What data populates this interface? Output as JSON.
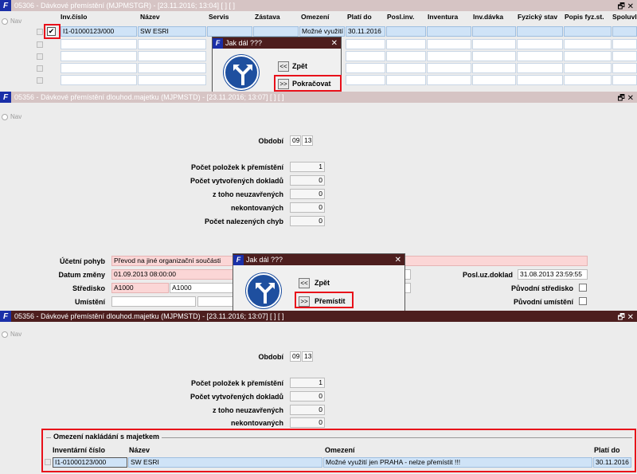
{
  "win1": {
    "title": "05306 - Dávkové přemístění (MJPMSTGR) - [23.11.2016; 13:04]  [ ]  [ ]",
    "nav": "Nav",
    "columns": [
      "Inv.číslo",
      "Název",
      "Servis",
      "Zástava",
      "Omezení",
      "Platí do",
      "Posl.inv.",
      "Inventura",
      "Inv.dávka",
      "Fyzický stav",
      "Popis fyz.st.",
      "Spoluvla"
    ],
    "row": {
      "inv": "I1-01000123/000",
      "name": "SW ESRI",
      "omezeni": "Možné využití",
      "plati": "30.11.2016",
      "check": "✔"
    },
    "dialog": {
      "title": "Jak dál ???",
      "close": "✕",
      "back_btn": "<<",
      "back_label": "Zpět",
      "next_btn": ">>",
      "next_label": "Pokračovat"
    }
  },
  "win2": {
    "title": "05356 - Dávkové přemístění dlouhod.majetku (MJPMSTD) - [23.11.2016; 13:07]  [ ]  [ ]",
    "nav": "Nav",
    "obdobi_label": "Období",
    "obdobi": [
      "09",
      "13"
    ],
    "stats": [
      {
        "label": "Počet položek k přemístění",
        "value": "1"
      },
      {
        "label": "Počet vytvořených dokladů",
        "value": "0"
      },
      {
        "label": "z toho     neuzavřených",
        "value": "0"
      },
      {
        "label": "nekontovaných",
        "value": "0"
      },
      {
        "label": "Počet nalezených chyb",
        "value": "0"
      }
    ],
    "ucetni_pohyb_label": "Účetní pohyb",
    "ucetni_pohyb": "Převod na jiné organizační součásti",
    "datum_zmeny_label": "Datum změny",
    "datum_zmeny": "01.09.2013 08:00:00",
    "stredisko_label": "Středisko",
    "stredisko": "A1000",
    "stredisko2": "A1000",
    "umisteni_label": "Umístění",
    "posl_doklad_label": "Posl.uz.doklad",
    "posl_doklad": "31.08.2013 23:59:55",
    "puvodni_stredisko_label": "Původní středisko",
    "puvodni_umisteni_label": "Původní umístění",
    "dialog": {
      "title": "Jak dál ???",
      "close": "✕",
      "back_btn": "<<",
      "back_label": "Zpět",
      "next_btn": ">>",
      "next_label": "Přemístit"
    }
  },
  "win3": {
    "title": "05356 - Dávkové přemístění dlouhod.majetku (MJPMSTD) - [23.11.2016; 13:07]  [ ]  [ ]",
    "nav": "Nav",
    "obdobi_label": "Období",
    "obdobi": [
      "09",
      "13"
    ],
    "stats": [
      {
        "label": "Počet položek k přemístění",
        "value": "1"
      },
      {
        "label": "Počet vytvořených dokladů",
        "value": "0"
      },
      {
        "label": "z toho     neuzavřených",
        "value": "0"
      },
      {
        "label": "nekontovaných",
        "value": "0"
      }
    ],
    "group_title": "Omezení nakládání s majetkem",
    "columns": [
      "Inventární číslo",
      "Název",
      "Omezení",
      "Platí do"
    ],
    "row": {
      "inv": "I1-01000123/000",
      "name": "SW ESRI",
      "omezeni": "Možné využití jen PRAHA - nelze přemístit !!!",
      "plati": "30.11.2016"
    }
  },
  "window_buttons": "🗗 ✕",
  "colors": {
    "highlight": "#e8101a",
    "active_title": "#4d1e1e",
    "inactive_title": "#d6c4c4",
    "pink_field": "#fbd6d6",
    "selected": "#cfe3f7"
  }
}
